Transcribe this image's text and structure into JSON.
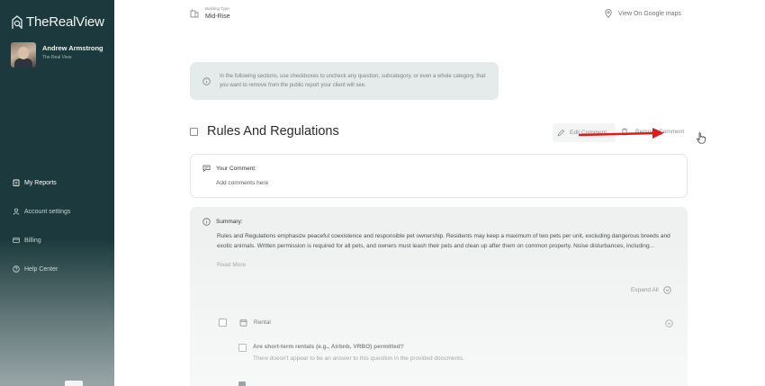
{
  "app": {
    "name": "TheRealView"
  },
  "user": {
    "name": "Andrew Armstrong",
    "org": "The Real View"
  },
  "sidebar": {
    "items": [
      {
        "label": "My Reports",
        "icon": "clipboard-icon",
        "active": true
      },
      {
        "label": "Account settings",
        "icon": "user-icon",
        "active": false
      },
      {
        "label": "Billing",
        "icon": "card-icon",
        "active": false
      },
      {
        "label": "Help Center",
        "icon": "help-icon",
        "active": false
      }
    ]
  },
  "header": {
    "building_type_label": "Building Type",
    "building_type_value": "Mid-Rise",
    "map_link": "View On Google maps"
  },
  "info": {
    "text": "In the following sections, use checkboxes to uncheck any question, subcategory, or even a whole category, that you want to remove from the public report your client will see."
  },
  "section": {
    "title": "Rules And Regulations",
    "edit_comment": "Edit Comment",
    "remove_comment": "Remove Comment"
  },
  "comment": {
    "label": "Your Comment:",
    "placeholder": "Add comments here"
  },
  "summary": {
    "label": "Summary:",
    "text": "Rules and Regulations emphasize peaceful coexistence and responsible pet ownership. Residents may keep a maximum of two pets per unit, excluding dangerous breeds and exotic animals. Written permission is required for all pets, and owners must leash their pets and clean up after them on common property. Noise disturbances, including...",
    "read_more": "Read More",
    "expand_all": "Expand All"
  },
  "subcategory": {
    "label": "Rental",
    "question": "Are short-term rentals (e.g., Airbnb, VRBO) permitted?",
    "answer": "There doesn't appear to be an answer to this question in the provided documents."
  },
  "colors": {
    "sidebar_bg": "#1c3a3d",
    "info_bg": "#e4ebea",
    "summary_bg": "#eef1f0",
    "arrow": "#e01b1b"
  }
}
